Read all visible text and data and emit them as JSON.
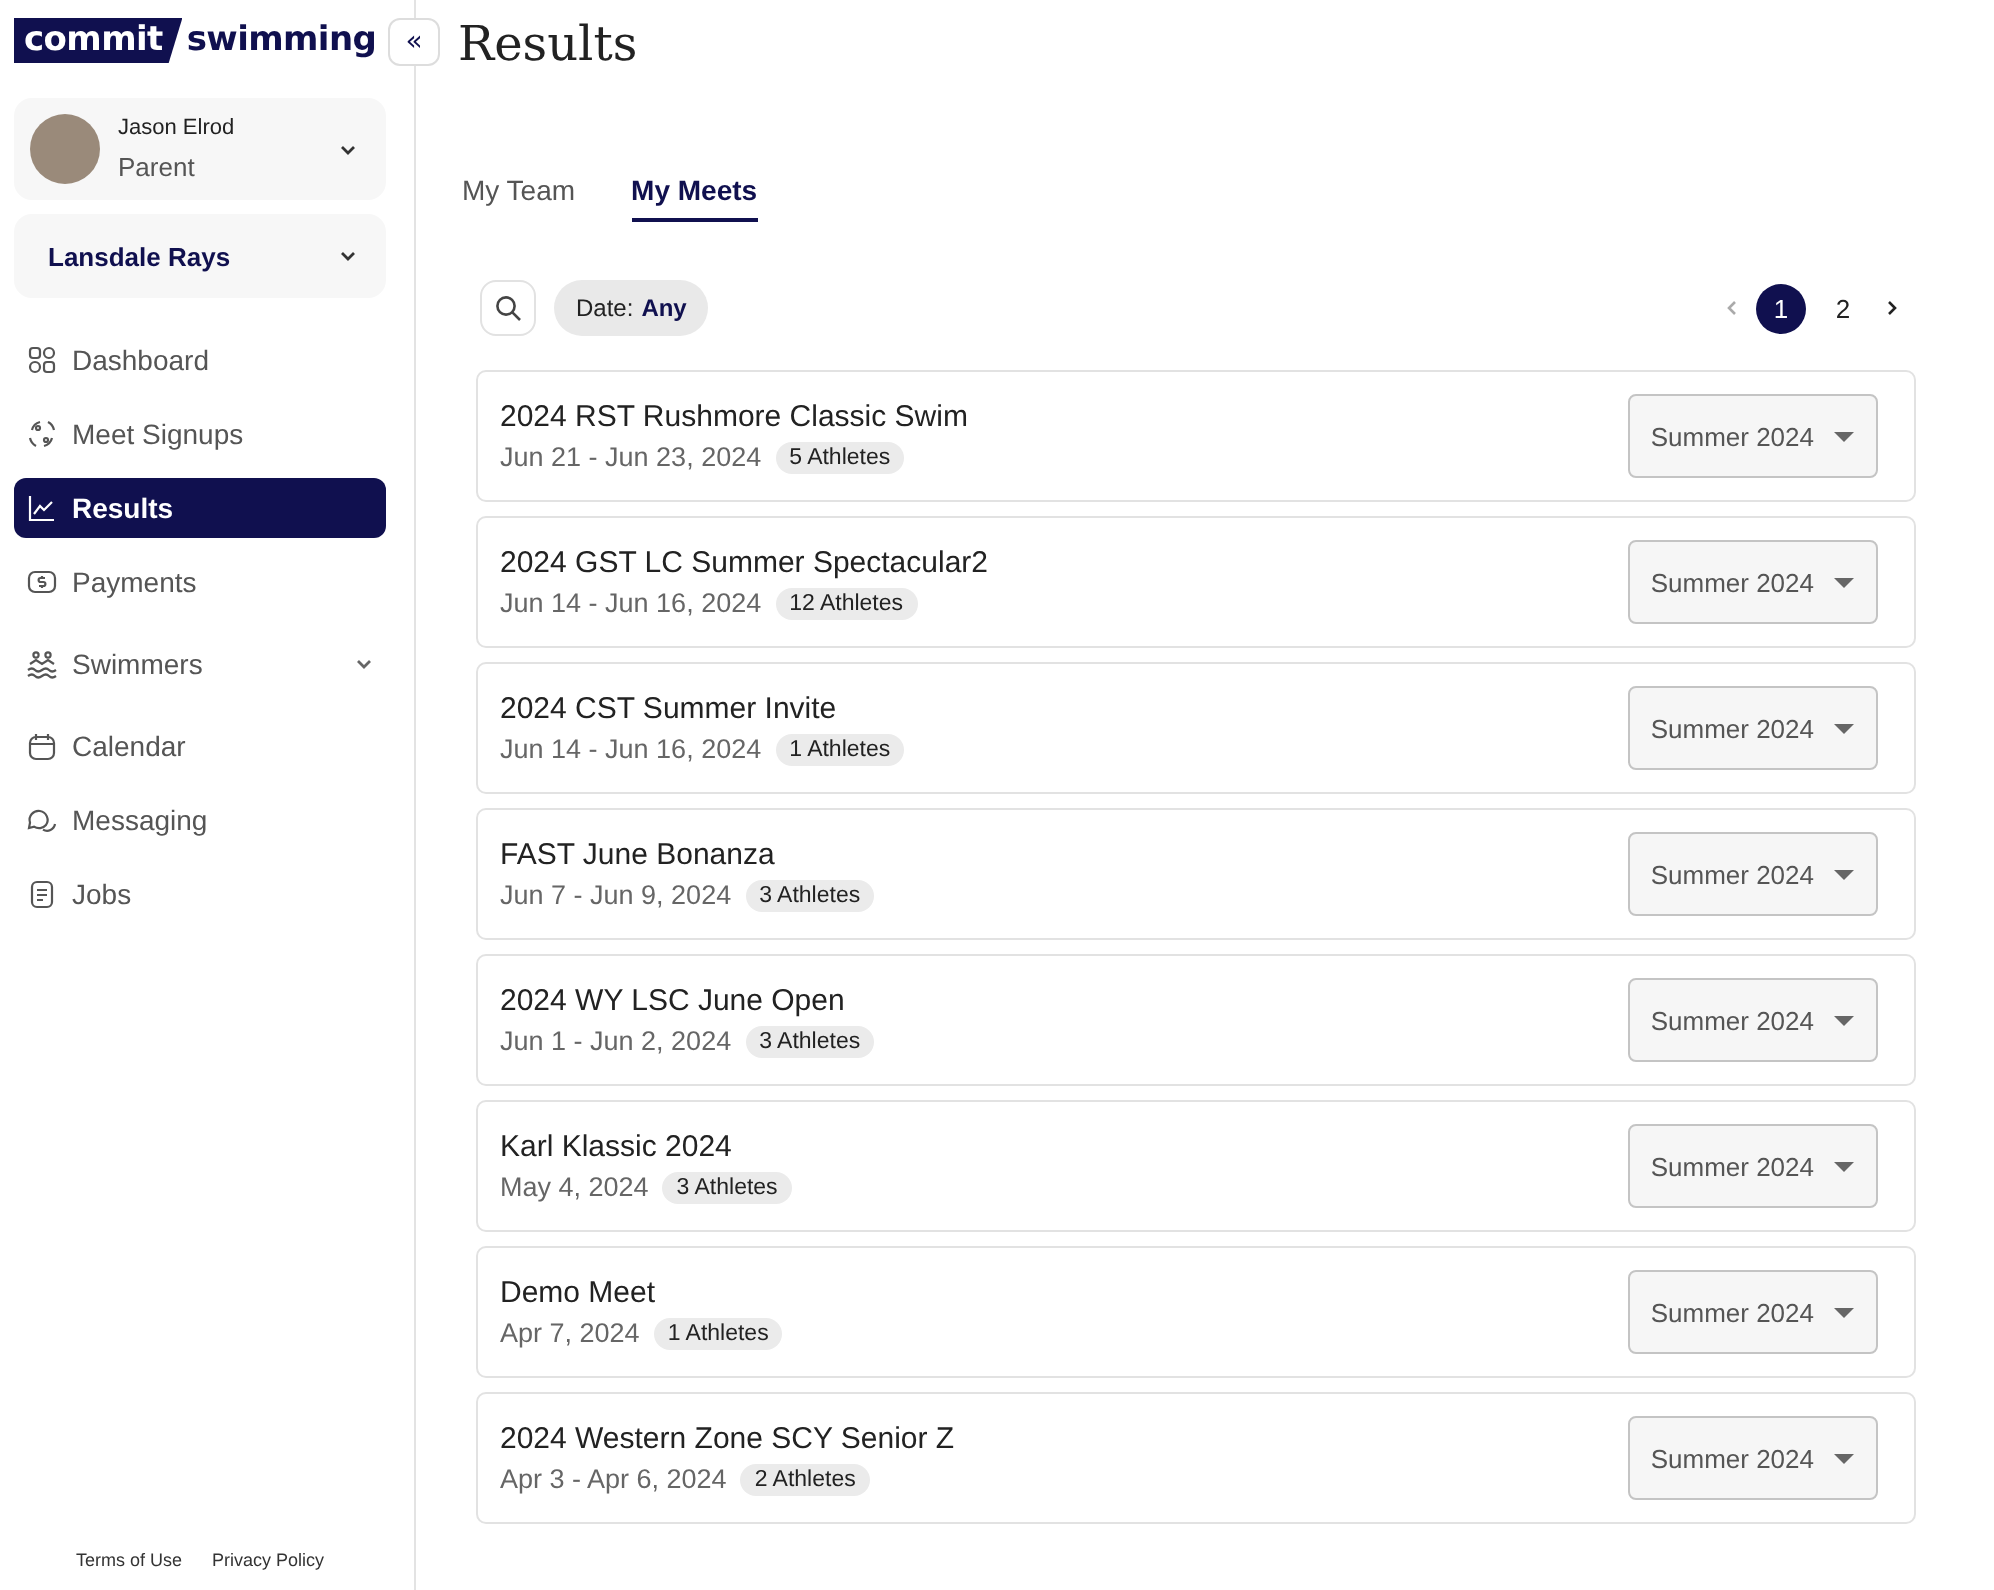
{
  "logo": {
    "part_1": "commit",
    "part_2": "swimming"
  },
  "collapse_button": "«",
  "user": {
    "name": "Jason Elrod",
    "role": "Parent"
  },
  "team": "Lansdale Rays",
  "nav": [
    {
      "label": "Dashboard",
      "selected": false,
      "has_submenu": false
    },
    {
      "label": "Meet Signups",
      "selected": false,
      "has_submenu": false
    },
    {
      "label": "Results",
      "selected": true,
      "has_submenu": false
    },
    {
      "label": "Payments",
      "selected": false,
      "has_submenu": false
    },
    {
      "label": "Swimmers",
      "selected": false,
      "has_submenu": true
    },
    {
      "label": "Calendar",
      "selected": false,
      "has_submenu": false
    },
    {
      "label": "Messaging",
      "selected": false,
      "has_submenu": false
    },
    {
      "label": "Jobs",
      "selected": false,
      "has_submenu": false
    }
  ],
  "footer_links": [
    "Terms of Use",
    "Privacy Policy"
  ],
  "page_title": "Results",
  "tabs": [
    {
      "label": "My Team",
      "selected": false
    },
    {
      "label": "My Meets",
      "selected": true
    }
  ],
  "date_filter": {
    "label": "Date:",
    "value": "Any"
  },
  "pages": [
    {
      "label": "1",
      "selected": true
    },
    {
      "label": "2",
      "selected": false
    }
  ],
  "meets": [
    {
      "name": "2024 RST Rushmore Classic Swim",
      "dates": "Jun 21 - Jun 23, 2024",
      "athletes": "5 Athletes",
      "season": "Summer 2024"
    },
    {
      "name": "2024 GST LC Summer Spectacular2",
      "dates": "Jun 14 - Jun 16, 2024",
      "athletes": "12 Athletes",
      "season": "Summer 2024"
    },
    {
      "name": "2024 CST Summer Invite",
      "dates": "Jun 14 - Jun 16, 2024",
      "athletes": "1 Athletes",
      "season": "Summer 2024"
    },
    {
      "name": "FAST June Bonanza",
      "dates": "Jun 7 - Jun 9, 2024",
      "athletes": "3 Athletes",
      "season": "Summer 2024"
    },
    {
      "name": "2024 WY LSC June Open",
      "dates": "Jun 1 - Jun 2, 2024",
      "athletes": "3 Athletes",
      "season": "Summer 2024"
    },
    {
      "name": "Karl Klassic 2024",
      "dates": "May 4, 2024",
      "athletes": "3 Athletes",
      "season": "Summer 2024"
    },
    {
      "name": "Demo Meet",
      "dates": "Apr 7, 2024",
      "athletes": "1 Athletes",
      "season": "Summer 2024"
    },
    {
      "name": "2024 Western Zone SCY Senior Z",
      "dates": "Apr 3 - Apr 6, 2024",
      "athletes": "2 Athletes",
      "season": "Summer 2024"
    }
  ]
}
